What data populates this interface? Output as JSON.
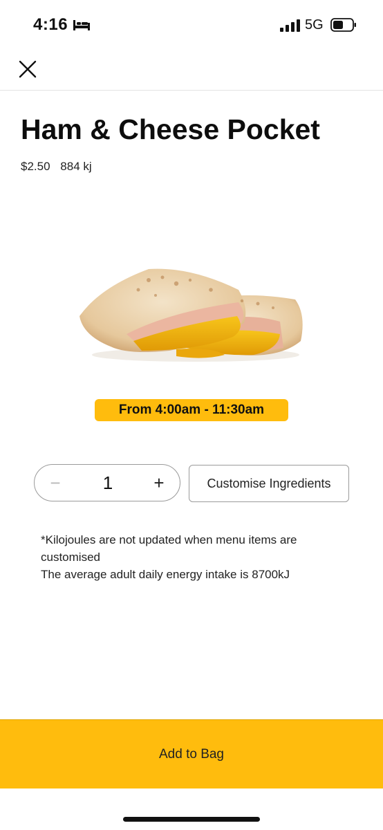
{
  "status_bar": {
    "time": "4:16",
    "network": "5G",
    "icons": [
      "bed-icon",
      "signal-icon",
      "battery-icon"
    ]
  },
  "nav": {
    "close_icon": "close-icon"
  },
  "product": {
    "title": "Ham & Cheese Pocket",
    "price": "$2.50",
    "energy": "884 kj",
    "availability": "From 4:00am - 11:30am"
  },
  "quantity": {
    "decrement_symbol": "−",
    "value": "1",
    "increment_symbol": "+"
  },
  "actions": {
    "customise_label": "Customise Ingredients",
    "add_to_bag_label": "Add to Bag"
  },
  "disclaimer": {
    "line1": "*Kilojoules are not updated when menu items are customised",
    "line2": "The average adult daily energy intake is 8700kJ"
  },
  "colors": {
    "accent": "#ffbc0d",
    "text": "#111111",
    "border": "#9a9a9a"
  }
}
